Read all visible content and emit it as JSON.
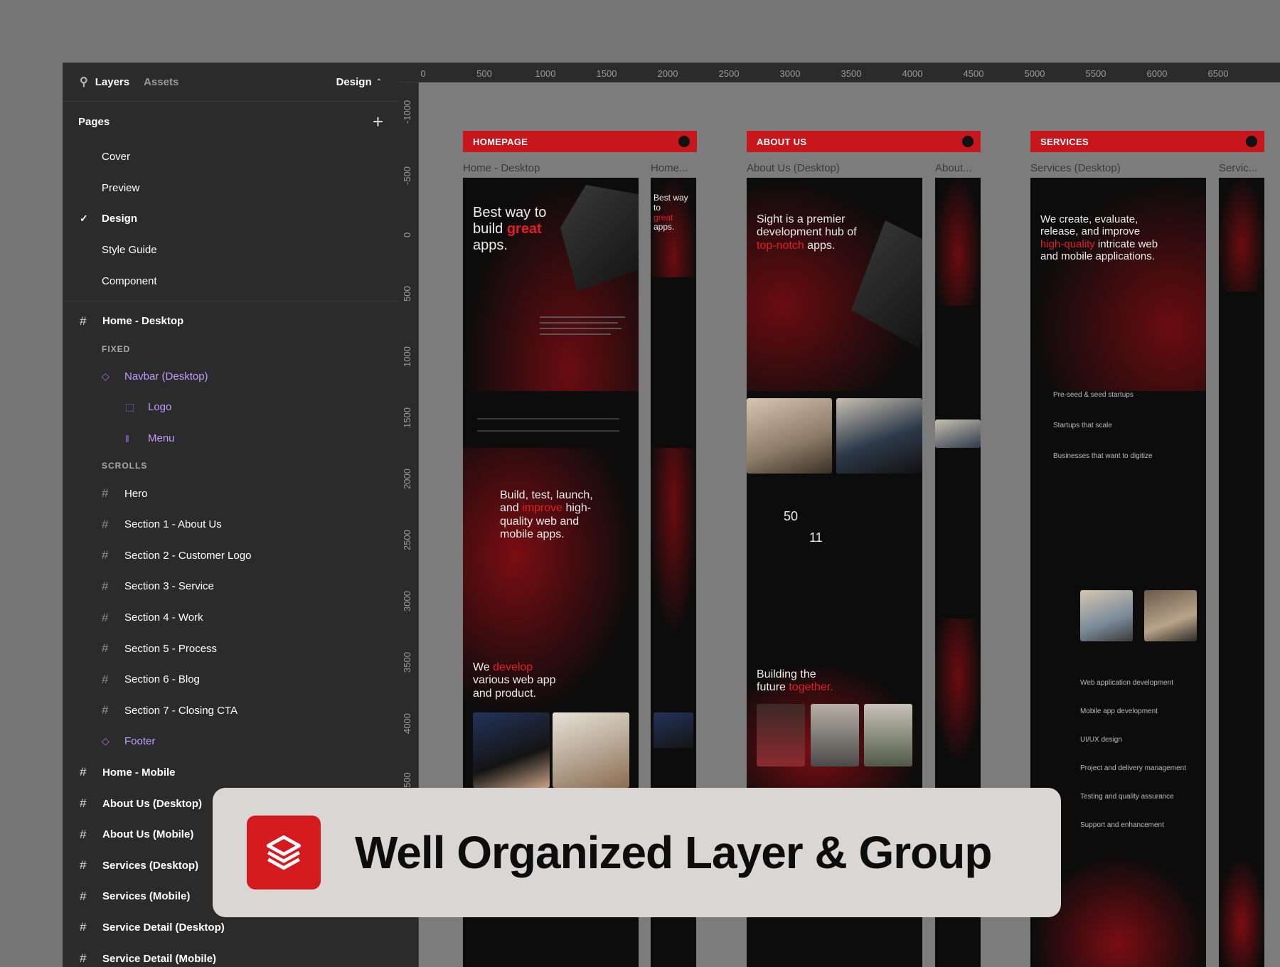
{
  "sidebar": {
    "tabs": {
      "layers": "Layers",
      "assets": "Assets"
    },
    "mode": "Design",
    "pages_title": "Pages",
    "pages": [
      "Cover",
      "Preview",
      "Design",
      "Style Guide",
      "Component"
    ],
    "active_page": "Design",
    "frames": {
      "home_desktop": "Home - Desktop",
      "fixed_label": "FIXED",
      "navbar": "Navbar (Desktop)",
      "logo": "Logo",
      "menu": "Menu",
      "scrolls_label": "SCROLLS",
      "sections": [
        "Hero",
        "Section 1 - About Us",
        "Section 2 - Customer Logo",
        "Section 3 - Service",
        "Section 4 - Work",
        "Section 5 - Process",
        "Section 6 - Blog",
        "Section 7 - Closing CTA"
      ],
      "footer": "Footer",
      "others": [
        "Home - Mobile",
        "About Us (Desktop)",
        "About Us (Mobile)",
        "Services (Desktop)",
        "Services (Mobile)",
        "Service Detail (Desktop)",
        "Service Detail (Mobile)"
      ]
    }
  },
  "ruler": {
    "top": [
      "0",
      "500",
      "1000",
      "1500",
      "2000",
      "2500",
      "3000",
      "3500",
      "4000",
      "4500",
      "5000",
      "5500",
      "6000",
      "6500"
    ],
    "left": [
      "-1000",
      "-500",
      "0",
      "500",
      "1000",
      "1500",
      "2000",
      "2500",
      "3000",
      "3500",
      "4000",
      "500"
    ]
  },
  "canvas": {
    "banners": {
      "homepage": "HOMEPAGE",
      "about": "ABOUT US",
      "services": "SERVICES"
    },
    "frame_labels": {
      "home_desktop": "Home - Desktop",
      "home_mobile": "Home...",
      "about_desktop": "About Us (Desktop)",
      "about_mobile": "About...",
      "services_desktop": "Services (Desktop)",
      "services_mobile": "Servic..."
    },
    "home": {
      "hero_a": "Best way to",
      "hero_b": "build ",
      "hero_red": "great",
      "hero_c": "apps.",
      "mid_a": "Build, test, launch,",
      "mid_b": "and ",
      "mid_red": "improve",
      "mid_c": " high-",
      "mid_d": "quality web and",
      "mid_e": "mobile apps.",
      "dev_red": "develop",
      "dev_a": "We ",
      "dev_b": "various web app",
      "dev_c": "and product."
    },
    "about": {
      "hero_a": "Sight is a premier",
      "hero_b": "development hub of",
      "hero_red": "top-notch",
      "hero_c": " apps.",
      "stat1": "50",
      "stat2": "11",
      "build_a": "Building the",
      "build_b": "future ",
      "build_red": "together."
    },
    "services": {
      "hero_a": "We create, evaluate,",
      "hero_b": "release, and improve",
      "hero_red": "high-quality",
      "hero_c": " intricate web",
      "hero_d": "and mobile applications.",
      "items": [
        "Web application development",
        "Mobile app development",
        "UI/UX design",
        "Project and delivery management",
        "Testing and quality assurance",
        "Support and enhancement"
      ],
      "stages": [
        "Pre-seed & seed startups",
        "Startups that scale",
        "Businesses that want to digitize"
      ]
    }
  },
  "overlay": {
    "title": "Well Organized Layer & Group",
    "icon": "layers-icon"
  },
  "colors": {
    "accent": "#c8161d",
    "sidebar_bg": "#2b2b2b",
    "component": "#c398ff"
  }
}
